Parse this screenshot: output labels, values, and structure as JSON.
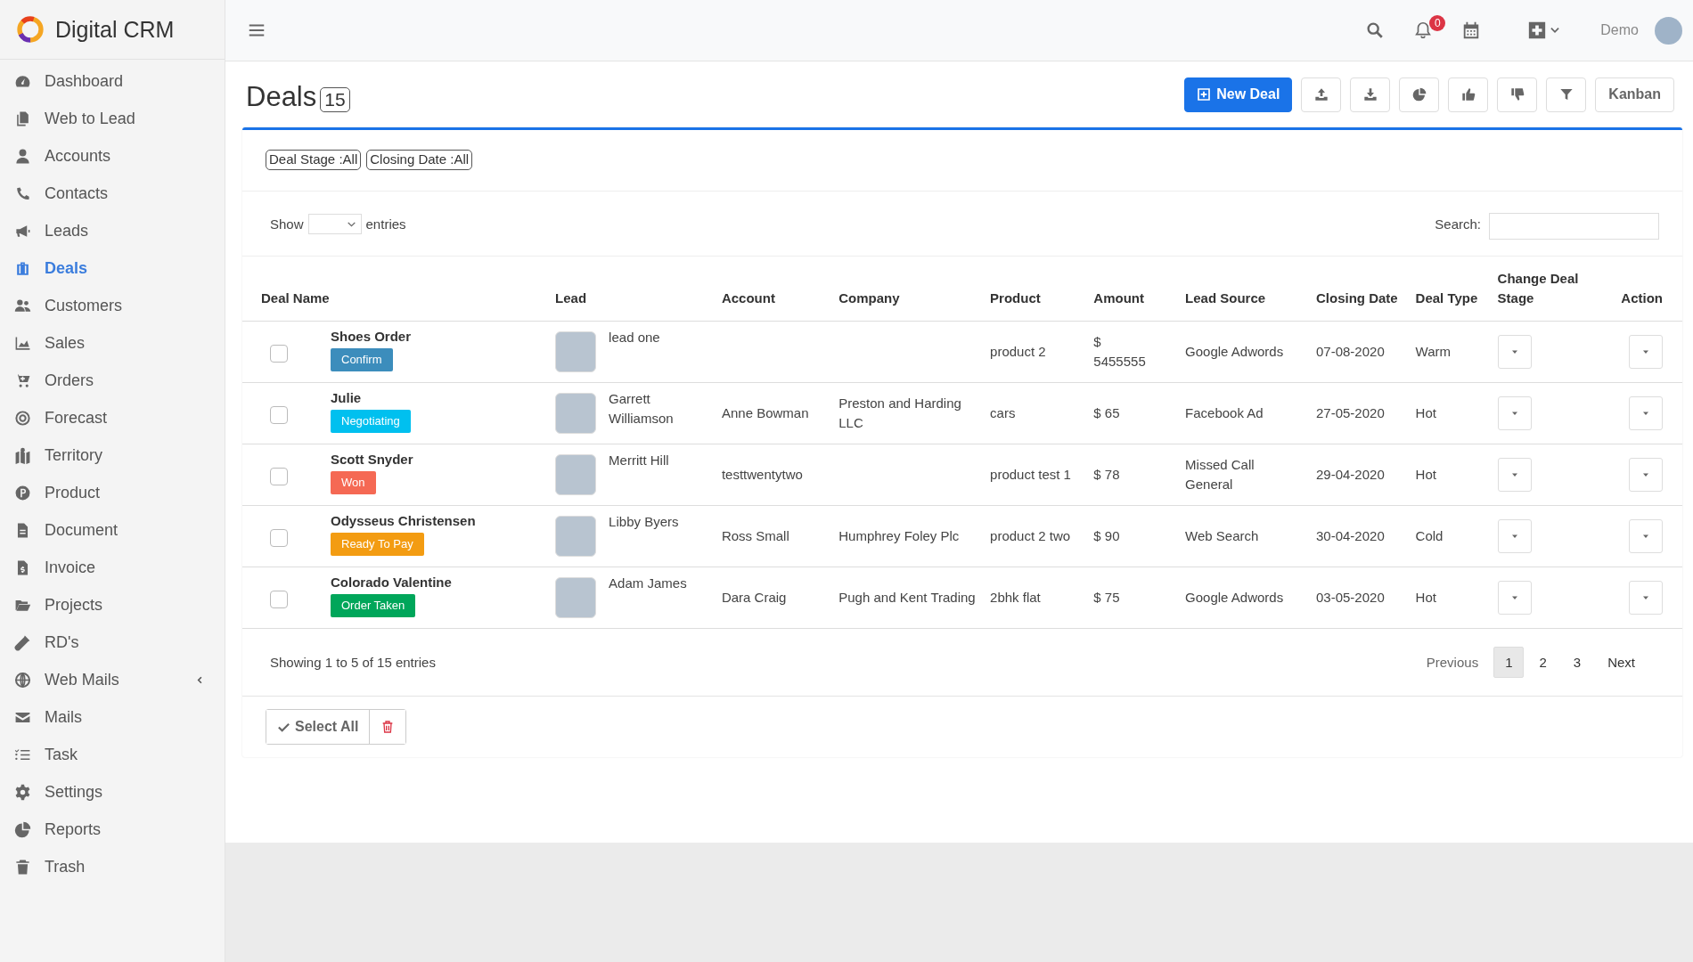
{
  "sidebar": {
    "brand": "Digital CRM",
    "items": [
      {
        "label": "Dashboard",
        "selected": false
      },
      {
        "label": "Web to Lead",
        "selected": false
      },
      {
        "label": "Accounts",
        "selected": false
      },
      {
        "label": "Contacts",
        "selected": false
      },
      {
        "label": "Leads",
        "selected": false
      },
      {
        "label": "Deals",
        "selected": true
      },
      {
        "label": "Customers",
        "selected": false
      },
      {
        "label": "Sales",
        "selected": false
      },
      {
        "label": "Orders",
        "selected": false
      },
      {
        "label": "Forecast",
        "selected": false
      },
      {
        "label": "Territory",
        "selected": false
      },
      {
        "label": "Product",
        "selected": false
      },
      {
        "label": "Document",
        "selected": false
      },
      {
        "label": "Invoice",
        "selected": false
      },
      {
        "label": "Projects",
        "selected": false
      },
      {
        "label": "RD's",
        "selected": false
      },
      {
        "label": "Web Mails",
        "selected": false,
        "expanded": false
      },
      {
        "label": "Mails",
        "selected": false
      },
      {
        "label": "Task",
        "selected": false
      },
      {
        "label": "Settings",
        "selected": false
      },
      {
        "label": "Reports",
        "selected": false
      },
      {
        "label": "Trash",
        "selected": false
      }
    ]
  },
  "topbar": {
    "notification_count": "0",
    "user": "Demo"
  },
  "page": {
    "title": "Deals",
    "count": "15",
    "new_button": "New Deal",
    "kanban_button": "Kanban"
  },
  "filters": [
    "Deal Stage :All",
    "Closing Date :All"
  ],
  "table_controls": {
    "show_label": "Show",
    "entries_label": "entries",
    "search_label": "Search:"
  },
  "table": {
    "columns": [
      "Deal Name",
      "Lead",
      "Account",
      "Company",
      "Product",
      "Amount",
      "Lead Source",
      "Closing Date",
      "Deal Type",
      "Change Deal Stage",
      "Action"
    ],
    "rows": [
      {
        "checked": false,
        "deal_name": "Shoes Order",
        "stage": "Confirm",
        "color": "#3c8dbc",
        "lead": "lead one",
        "account": "",
        "company": "",
        "product": "product 2",
        "amount": "$ 5455555",
        "lead_source": "Google Adwords",
        "closing_date": "07-08-2020",
        "deal_type": "Warm"
      },
      {
        "checked": false,
        "deal_name": "Julie",
        "stage": "Negotiating",
        "color": "#00c0ef",
        "lead": "Garrett Williamson",
        "account": "Anne Bowman",
        "company": "Preston and Harding LLC",
        "product": "cars",
        "amount": "$ 65",
        "lead_source": "Facebook Ad",
        "closing_date": "27-05-2020",
        "deal_type": "Hot"
      },
      {
        "checked": false,
        "deal_name": "Scott Snyder",
        "stage": "Won",
        "color": "#f56954",
        "lead": "Merritt Hill",
        "account": "testtwentytwo",
        "company": "",
        "product": "product test 1",
        "amount": "$ 78",
        "lead_source": "Missed Call General",
        "closing_date": "29-04-2020",
        "deal_type": "Hot"
      },
      {
        "checked": false,
        "deal_name": "Odysseus Christensen",
        "stage": "Ready To Pay",
        "color": "#f39c12",
        "lead": "Libby Byers",
        "account": "Ross Small",
        "company": "Humphrey Foley Plc",
        "product": "product 2 two",
        "amount": "$ 90",
        "lead_source": "Web Search",
        "closing_date": "30-04-2020",
        "deal_type": "Cold"
      },
      {
        "checked": false,
        "deal_name": "Colorado Valentine",
        "stage": "Order Taken",
        "color": "#00a65a",
        "lead": "Adam James",
        "account": "Dara Craig",
        "company": "Pugh and Kent Trading",
        "product": "2bhk flat",
        "amount": "$ 75",
        "lead_source": "Google Adwords",
        "closing_date": "03-05-2020",
        "deal_type": "Hot"
      }
    ]
  },
  "footer": {
    "info": "Showing 1 to 5 of 15 entries",
    "pagination": [
      {
        "label": "Previous",
        "kind": "nav",
        "selected": false
      },
      {
        "label": "1",
        "kind": "page",
        "selected": true
      },
      {
        "label": "2",
        "kind": "page",
        "selected": false
      },
      {
        "label": "3",
        "kind": "page",
        "selected": false
      },
      {
        "label": "Next",
        "kind": "nav",
        "selected": false
      }
    ],
    "select_all": "Select All"
  }
}
